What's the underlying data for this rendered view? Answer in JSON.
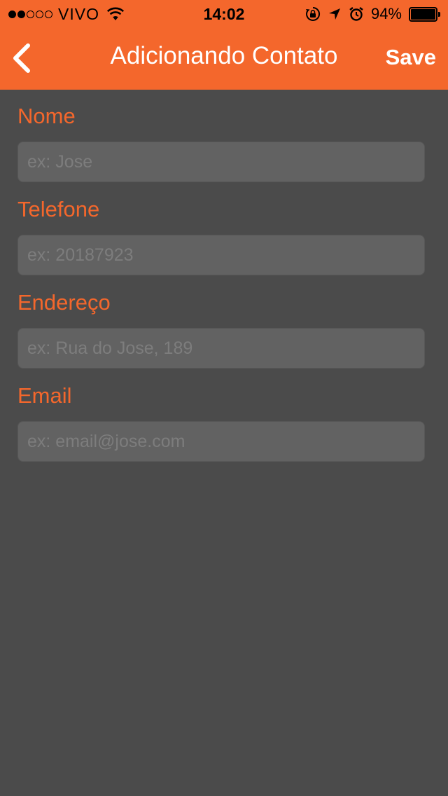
{
  "status_bar": {
    "carrier": "VIVO",
    "time": "14:02",
    "battery": "94%"
  },
  "nav": {
    "title": "Adicionando Contato",
    "save_label": "Save",
    "back_icon": "chevron-left-icon"
  },
  "form": {
    "fields": [
      {
        "label": "Nome",
        "placeholder": "ex: Jose"
      },
      {
        "label": "Telefone",
        "placeholder": "ex: 20187923"
      },
      {
        "label": "Endereço",
        "placeholder": "ex: Rua do Jose, 189"
      },
      {
        "label": "Email",
        "placeholder": "ex: email@jose.com"
      }
    ]
  },
  "colors": {
    "accent": "#f4672c",
    "background": "#4b4b4b",
    "input_bg": "#626262"
  }
}
